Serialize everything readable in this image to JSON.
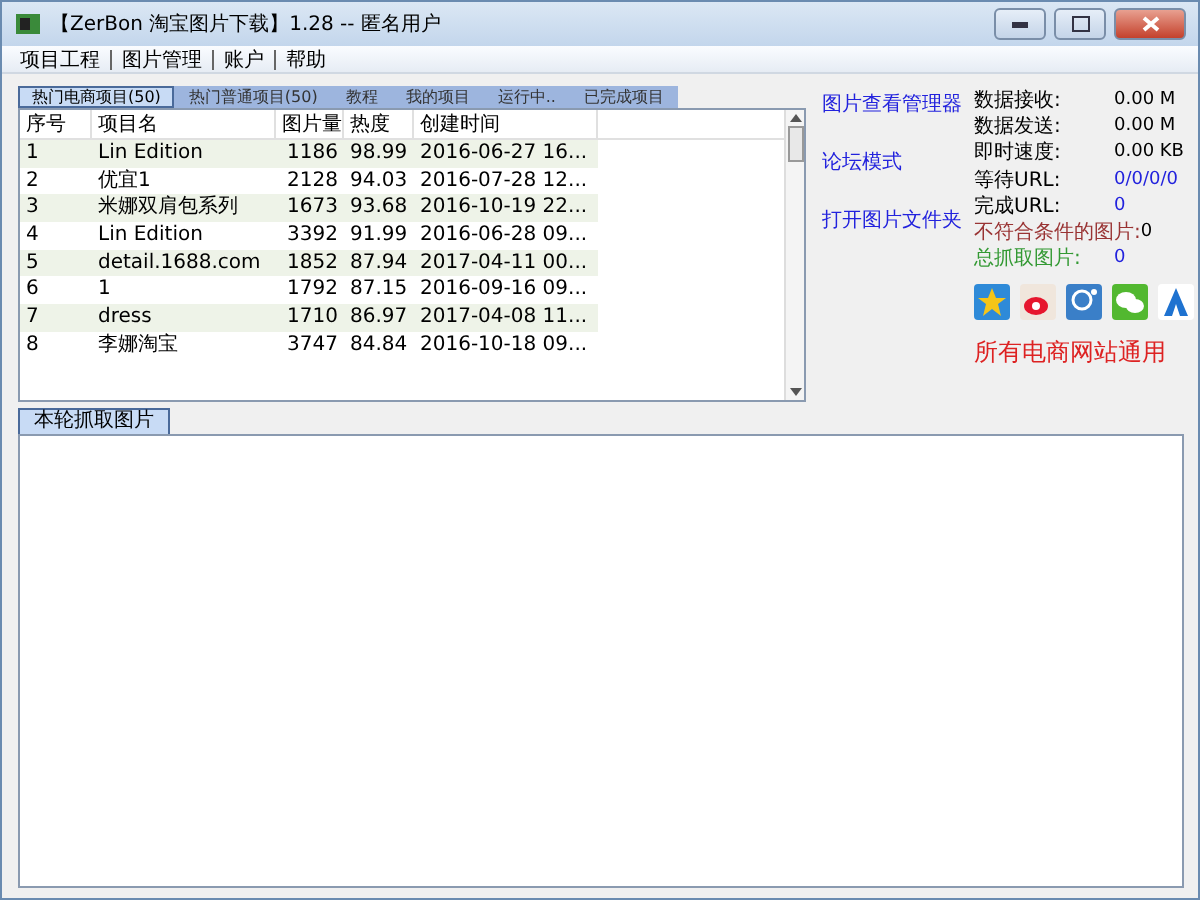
{
  "window": {
    "title": "【ZerBon 淘宝图片下载】1.28 -- 匿名用户"
  },
  "menu": [
    "项目工程",
    "图片管理",
    "账户",
    "帮助"
  ],
  "tabs": [
    {
      "label": "热门电商项目(50)",
      "selected": true
    },
    {
      "label": "热门普通项目(50)",
      "selected": false
    },
    {
      "label": "教程",
      "selected": false
    },
    {
      "label": "我的项目",
      "selected": false
    },
    {
      "label": "运行中..",
      "selected": false
    },
    {
      "label": "已完成项目",
      "selected": false
    }
  ],
  "table": {
    "columns": [
      "序号",
      "项目名",
      "图片量",
      "热度",
      "创建时间"
    ],
    "rows": [
      [
        "1",
        "Lin Edition",
        "1186",
        "98.99",
        "2016-06-27 16..."
      ],
      [
        "2",
        "优宜1",
        "2128",
        "94.03",
        "2016-07-28 12..."
      ],
      [
        "3",
        "米娜双肩包系列",
        "1673",
        "93.68",
        "2016-10-19 22..."
      ],
      [
        "4",
        "Lin Edition",
        "3392",
        "91.99",
        "2016-06-28 09..."
      ],
      [
        "5",
        "detail.1688.com",
        "1852",
        "87.94",
        "2017-04-11 00..."
      ],
      [
        "6",
        "1",
        "1792",
        "87.15",
        "2016-09-16 09..."
      ],
      [
        "7",
        "dress",
        "1710",
        "86.97",
        "2017-04-08 11..."
      ],
      [
        "8",
        "李娜淘宝",
        "3747",
        "84.84",
        "2016-10-18 09..."
      ]
    ]
  },
  "links": [
    "图片查看管理器",
    "论坛模式",
    "打开图片文件夹"
  ],
  "stats": [
    {
      "label": "数据接收:",
      "value": "0.00 M",
      "color": "#000000"
    },
    {
      "label": "数据发送:",
      "value": "0.00 M",
      "color": "#000000"
    },
    {
      "label": "即时速度:",
      "value": "0.00 KB",
      "color": "#000000"
    },
    {
      "label": "等待URL:",
      "value": "0/0/0/0",
      "color": "#000000"
    },
    {
      "label": "完成URL:",
      "value": "0",
      "color": "#000000"
    },
    {
      "label": "不符合条件的图片:",
      "value": "0",
      "color": "#993333"
    },
    {
      "label": "总抓取图片:",
      "value": "0",
      "color": "#339933"
    }
  ],
  "slogan": "所有电商网站通用",
  "bottom_tab": {
    "label": "本轮抓取图片",
    "selected": true
  }
}
